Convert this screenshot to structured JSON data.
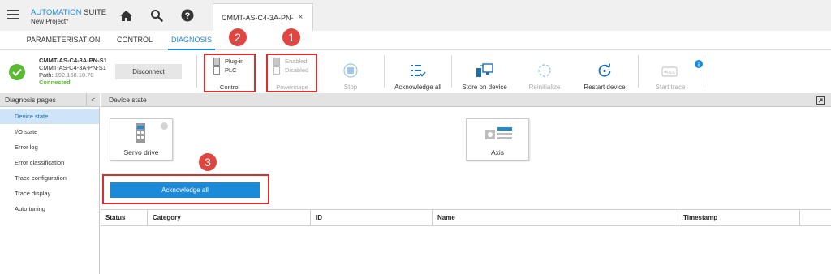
{
  "app": {
    "title_part1": "AUTOMATION",
    "title_part2": " SUITE",
    "project": "New Project*"
  },
  "doc_tab": {
    "label": "CMMT-AS-C4-3A-PN-",
    "close": "×"
  },
  "nav_tabs": [
    "PARAMETERISATION",
    "CONTROL",
    "DIAGNOSIS"
  ],
  "device": {
    "name": "CMMT-AS-C4-3A-PN-S1",
    "model": "CMMT-AS-C4-3A-PN-S1",
    "path_label": "Path:",
    "path": "192.168.10.70",
    "status": "Connected",
    "disconnect_label": "Disconnect"
  },
  "toolbar": {
    "control": {
      "opt1": "Plug-in",
      "opt2": "PLC",
      "label": "Control"
    },
    "powerstage": {
      "opt1": "Enabled",
      "opt2": "Disabled",
      "label": "Powerstage"
    },
    "stop": "Stop",
    "acknowledge_all": "Acknowledge all",
    "store_on_device": "Store on device",
    "reinitialize": "Reinitialize",
    "restart_device": "Restart device",
    "start_trace": "Start trace",
    "rec": "REC"
  },
  "badges": [
    "1",
    "2",
    "3"
  ],
  "left_panel": {
    "title": "Diagnosis pages",
    "collapse": "<",
    "items": [
      "Device state",
      "I/O state",
      "Error log",
      "Error classification",
      "Trace configuration",
      "Trace display",
      "Auto tuning"
    ]
  },
  "main": {
    "title": "Device state",
    "cards": {
      "servo": "Servo drive",
      "axis": "Axis"
    },
    "acknowledge_all_button": "Acknowledge all",
    "columns": [
      "Status",
      "Category",
      "ID",
      "Name",
      "Timestamp"
    ]
  },
  "colors": {
    "accent": "#1b8ad9",
    "connected": "#5bb932",
    "highlight": "#d9302f"
  }
}
